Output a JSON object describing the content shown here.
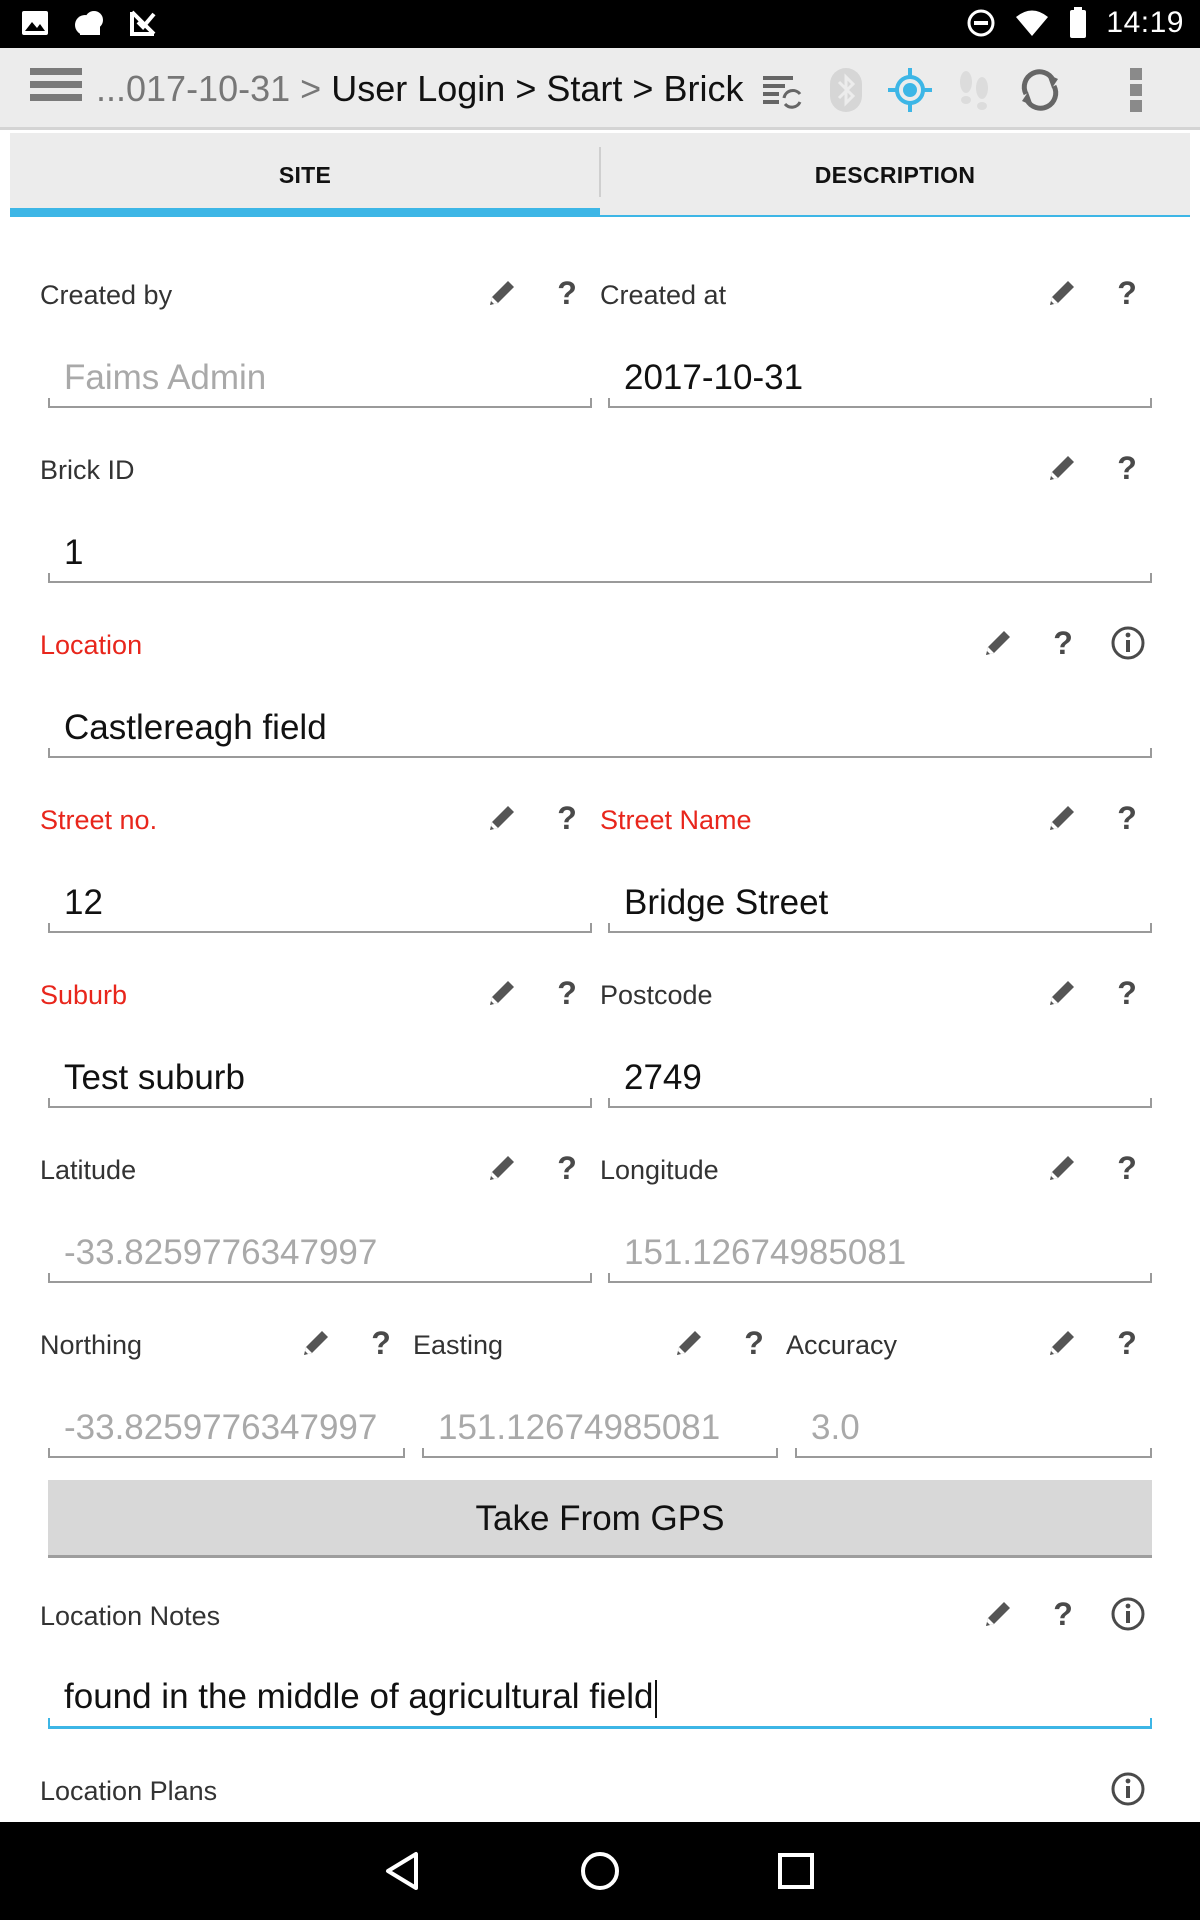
{
  "status_bar": {
    "time": "14:19",
    "left_icons": [
      "image-icon",
      "cloud-icon",
      "check-box-icon"
    ],
    "right_icons": [
      "do-not-disturb-icon",
      "wifi-icon",
      "battery-icon"
    ]
  },
  "action_bar": {
    "breadcrumb": {
      "truncated": "...017-10-31",
      "sep": ">",
      "items": [
        "User Login",
        "Start",
        "Brick"
      ]
    },
    "icons": [
      "sync-list-icon",
      "bluetooth-icon",
      "gps-target-icon",
      "footprints-icon",
      "refresh-icon",
      "overflow-menu-icon"
    ],
    "accent": "#3db6e6"
  },
  "tabs": [
    {
      "label": "SITE",
      "selected": true
    },
    {
      "label": "DESCRIPTION",
      "selected": false
    }
  ],
  "form": {
    "created_by": {
      "label": "Created by",
      "value": "Faims Admin"
    },
    "created_at": {
      "label": "Created at",
      "value": "2017-10-31"
    },
    "brick_id": {
      "label": "Brick ID",
      "value": "1"
    },
    "location": {
      "label": "Location",
      "value": "Castlereagh field"
    },
    "street_no": {
      "label": "Street no.",
      "value": "12"
    },
    "street_name": {
      "label": "Street Name",
      "value": "Bridge Street"
    },
    "suburb": {
      "label": "Suburb",
      "value": "Test suburb"
    },
    "postcode": {
      "label": "Postcode",
      "value": "2749"
    },
    "latitude": {
      "label": "Latitude",
      "value": "-33.8259776347997"
    },
    "longitude": {
      "label": "Longitude",
      "value": "151.12674985081"
    },
    "northing": {
      "label": "Northing",
      "value": "-33.8259776347997"
    },
    "easting": {
      "label": "Easting",
      "value": "151.12674985081"
    },
    "accuracy": {
      "label": "Accuracy",
      "value": "3.0"
    },
    "gps_button": "Take From GPS",
    "location_notes": {
      "label": "Location Notes",
      "value": "found in the middle of agricultural field"
    },
    "location_plans": {
      "label": "Location Plans"
    },
    "help_glyph": "?",
    "required_color": "#e8261c"
  }
}
